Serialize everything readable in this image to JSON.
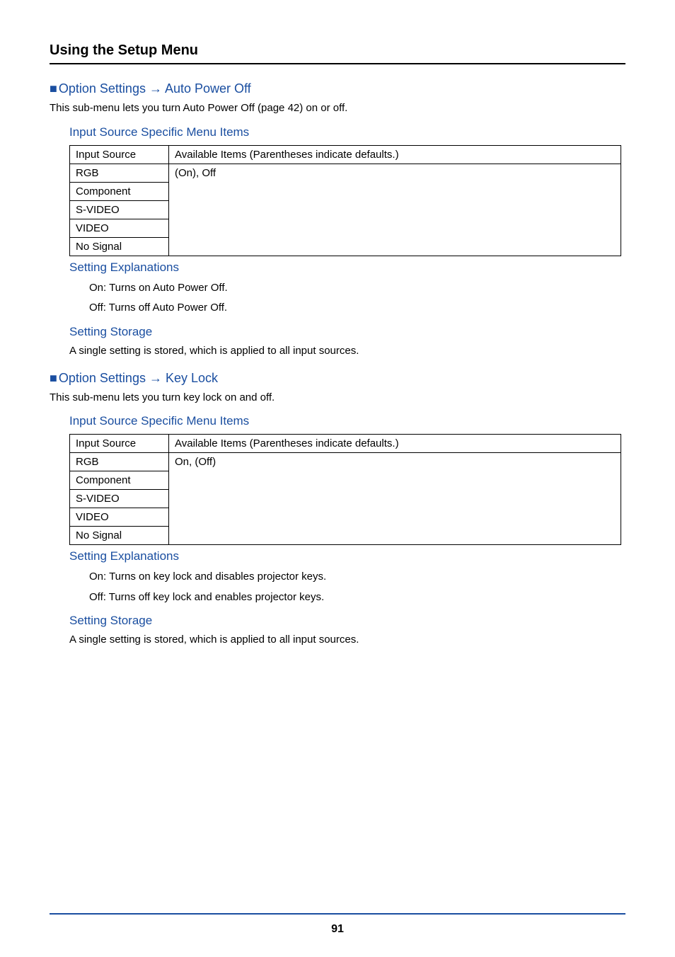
{
  "header": {
    "title": "Using the Setup Menu"
  },
  "section1": {
    "heading": "Option Settings → Auto Power Off",
    "desc": "This sub-menu lets you turn Auto Power Off (page 42) on or off.",
    "items_title": "Input Source Specific Menu Items",
    "table": {
      "hdr_source": "Input Source",
      "hdr_avail": "Available Items (Parentheses indicate defaults.)",
      "rows": [
        "RGB",
        "Component",
        "S-VIDEO",
        "VIDEO",
        "No Signal"
      ],
      "value": "(On), Off"
    },
    "expl_title": "Setting Explanations",
    "expl_on": "On: Turns on Auto Power Off.",
    "expl_off": "Off: Turns off Auto Power Off.",
    "storage_title": "Setting Storage",
    "storage_text": "A single setting is stored, which is applied to all input sources."
  },
  "section2": {
    "heading": "Option Settings → Key Lock",
    "desc": "This sub-menu lets you turn key lock on and off.",
    "items_title": "Input Source Specific Menu Items",
    "table": {
      "hdr_source": "Input Source",
      "hdr_avail": "Available Items (Parentheses indicate defaults.)",
      "rows": [
        "RGB",
        "Component",
        "S-VIDEO",
        "VIDEO",
        "No Signal"
      ],
      "value": "On, (Off)"
    },
    "expl_title": "Setting Explanations",
    "expl_on": "On: Turns on key lock and disables projector keys.",
    "expl_off": "Off: Turns off key lock and enables projector keys.",
    "storage_title": "Setting Storage",
    "storage_text": "A single setting is stored, which is applied to all input sources."
  },
  "page_number": "91"
}
